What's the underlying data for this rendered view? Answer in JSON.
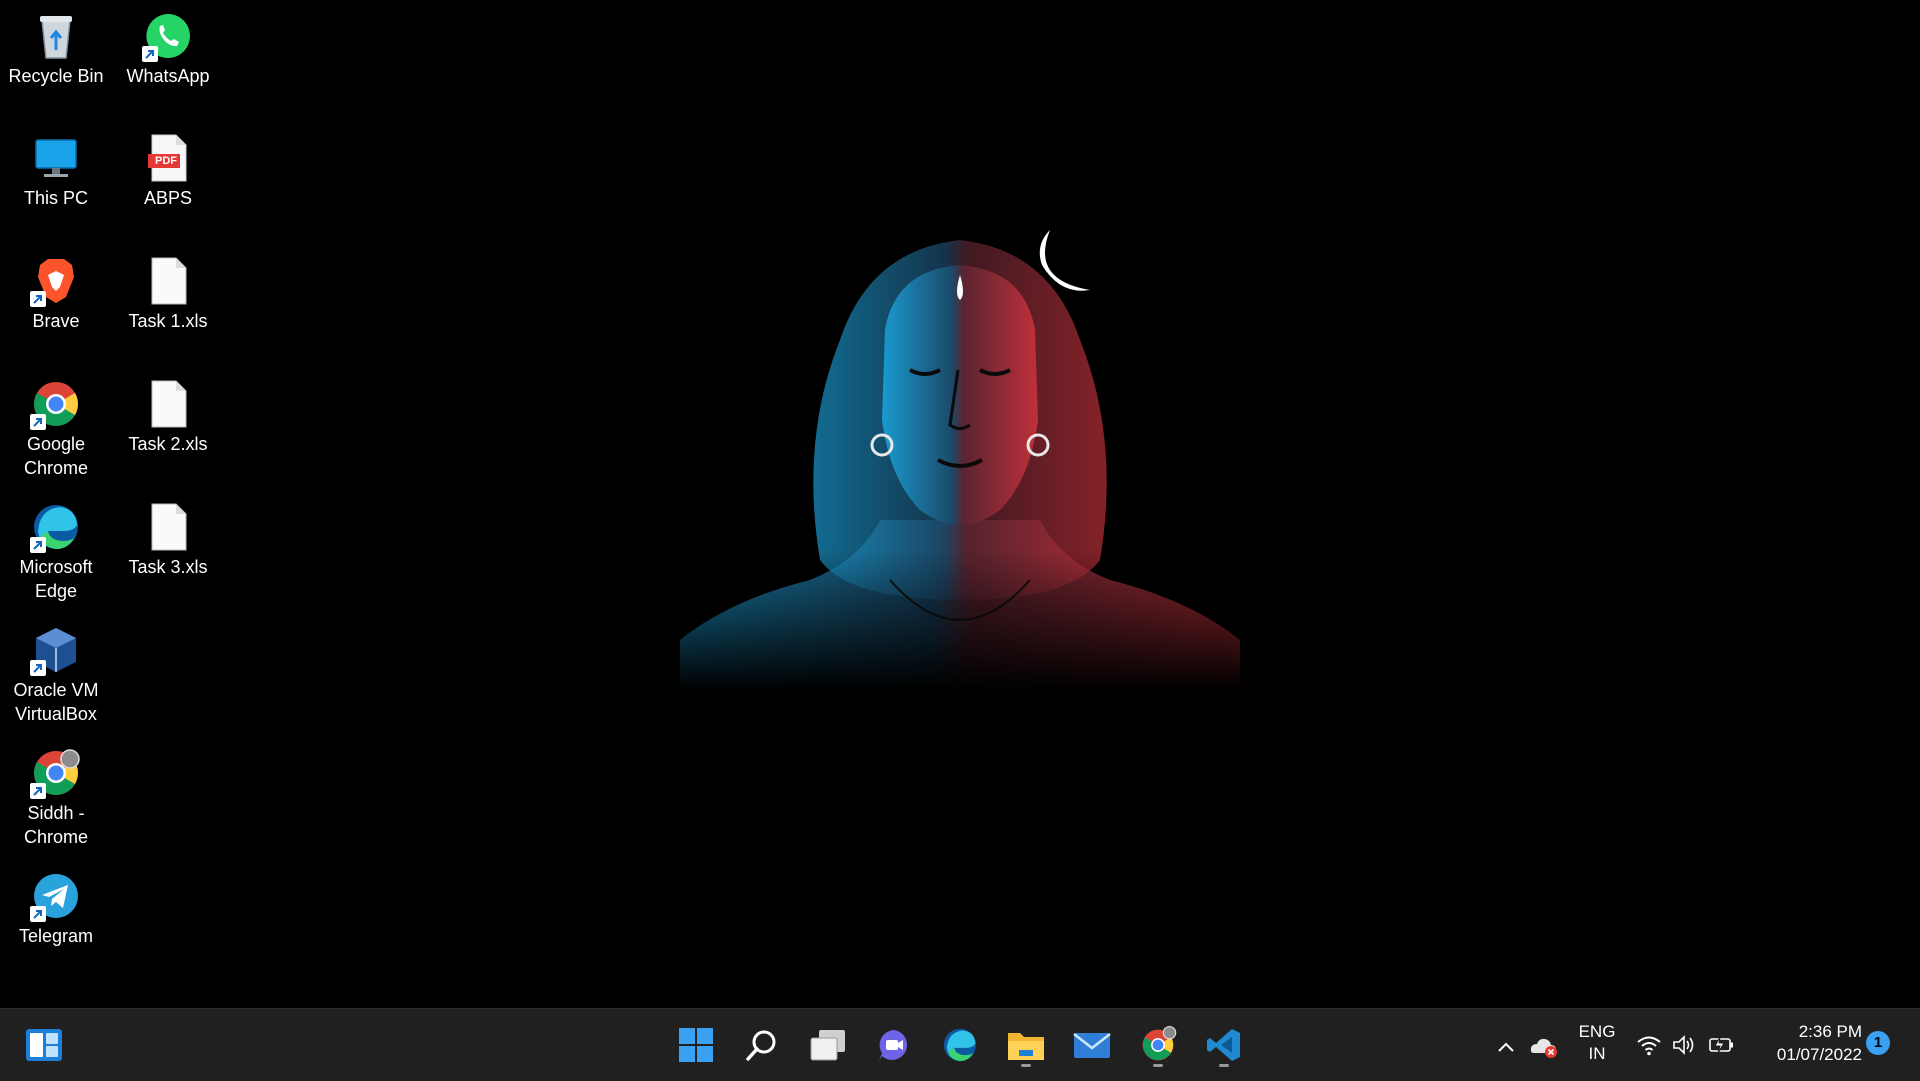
{
  "desktop": {
    "icons": [
      {
        "label": "Recycle Bin",
        "icon": "recycle-bin-icon"
      },
      {
        "label": "WhatsApp",
        "icon": "whatsapp-icon"
      },
      {
        "label": "This PC",
        "icon": "this-pc-icon"
      },
      {
        "label": "ABPS",
        "icon": "pdf-file-icon",
        "badge": "PDF"
      },
      {
        "label": "Brave",
        "icon": "brave-icon"
      },
      {
        "label": "Task 1.xls",
        "icon": "blank-file-icon"
      },
      {
        "label": "Google Chrome",
        "icon": "chrome-icon"
      },
      {
        "label": "Task 2.xls",
        "icon": "blank-file-icon"
      },
      {
        "label": "Microsoft Edge",
        "icon": "edge-icon"
      },
      {
        "label": "Task 3.xls",
        "icon": "blank-file-icon"
      },
      {
        "label": "Oracle VM VirtualBox",
        "icon": "virtualbox-icon"
      },
      {
        "label": "Siddh - Chrome",
        "icon": "chrome-profile-icon"
      },
      {
        "label": "Telegram",
        "icon": "telegram-icon"
      }
    ]
  },
  "taskbar": {
    "apps": [
      {
        "name": "start",
        "icon": "windows-start-icon"
      },
      {
        "name": "search",
        "icon": "search-icon"
      },
      {
        "name": "task-view",
        "icon": "task-view-icon"
      },
      {
        "name": "chat",
        "icon": "teams-chat-icon"
      },
      {
        "name": "edge",
        "icon": "edge-icon"
      },
      {
        "name": "file-explorer",
        "icon": "folder-icon"
      },
      {
        "name": "mail",
        "icon": "mail-icon"
      },
      {
        "name": "chrome",
        "icon": "chrome-icon"
      },
      {
        "name": "vscode",
        "icon": "vscode-icon"
      }
    ],
    "tray": {
      "lang_top": "ENG",
      "lang_bottom": "IN",
      "time": "2:36 PM",
      "date": "01/07/2022",
      "notification_count": "1"
    }
  },
  "colors": {
    "taskbar_bg": "#202020",
    "accent": "#0078d4"
  }
}
